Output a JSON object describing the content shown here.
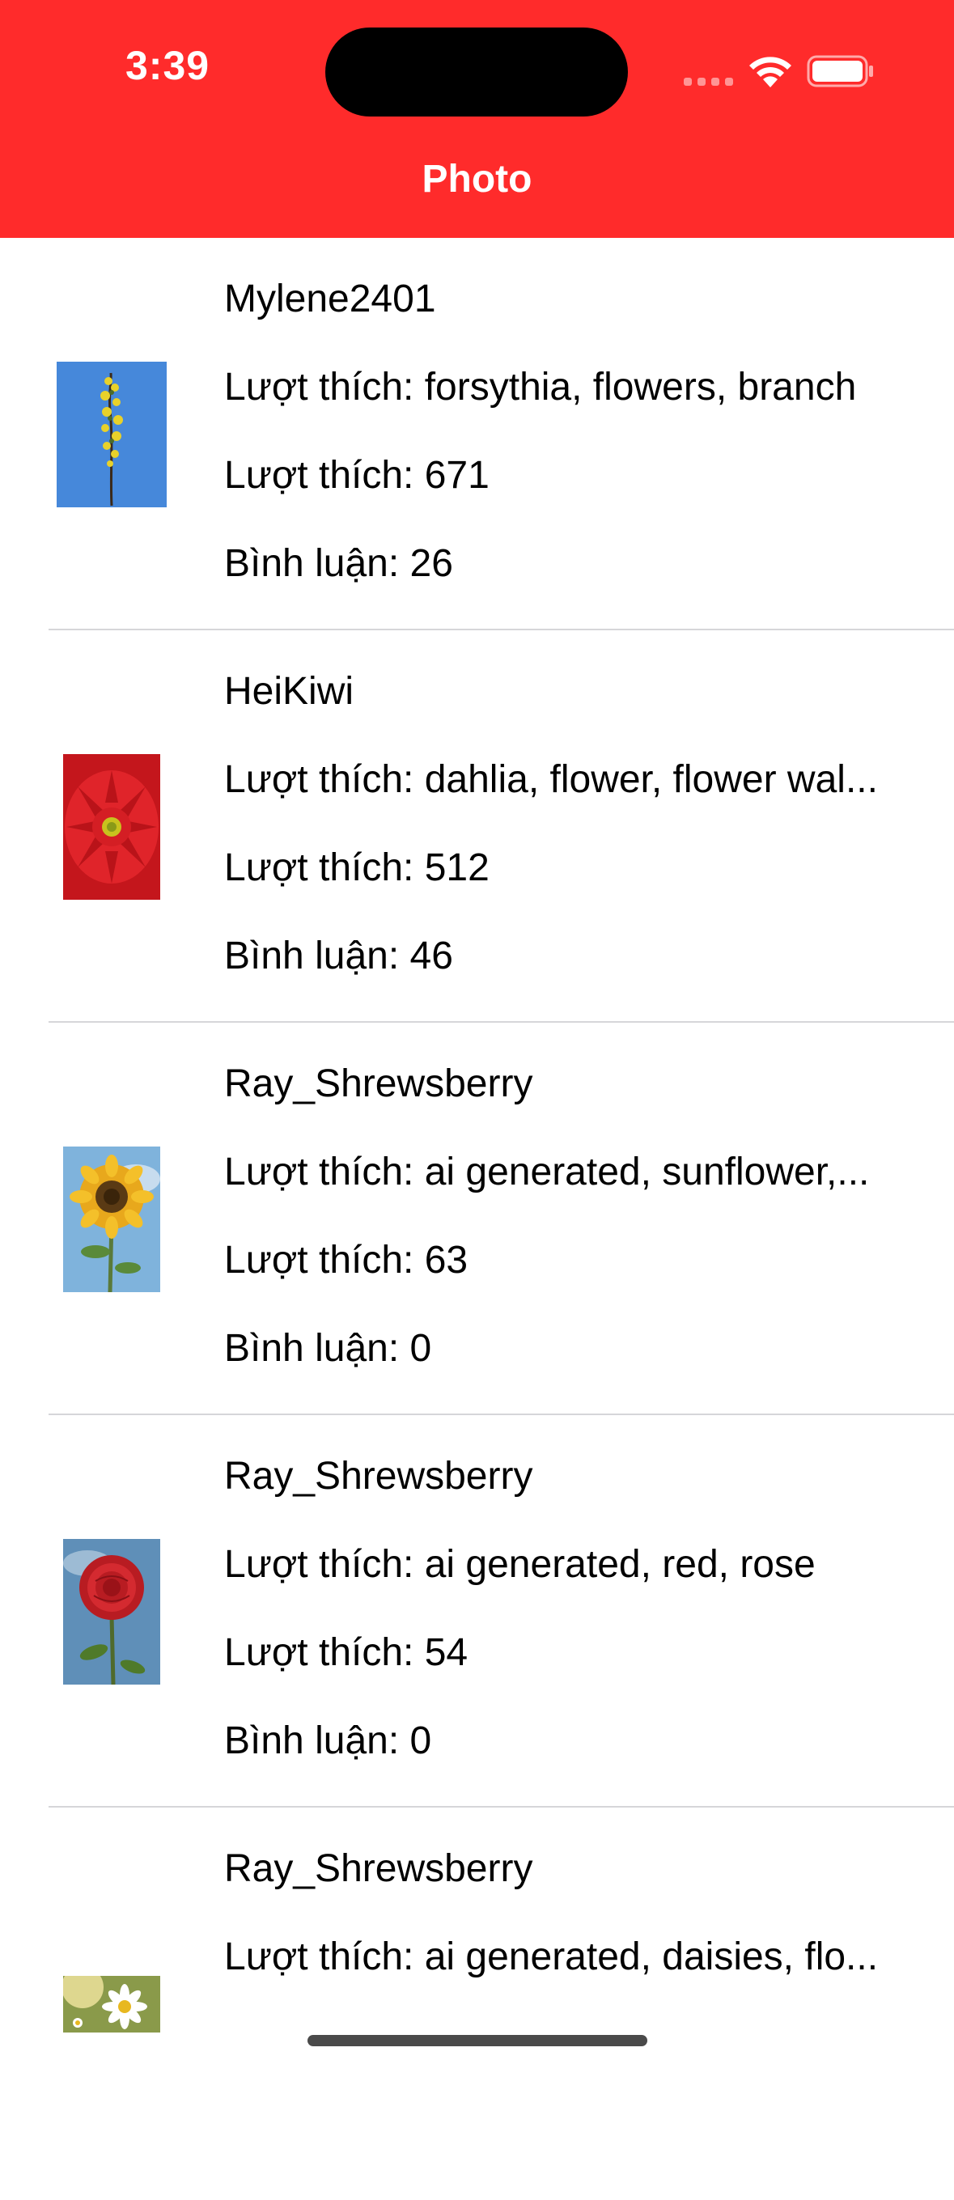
{
  "status_bar": {
    "time": "3:39"
  },
  "nav": {
    "title": "Photo"
  },
  "colors": {
    "header": "#ff2b2b",
    "separator": "#d6d6d9"
  },
  "photos": [
    {
      "user": "Mylene2401",
      "tags": "Lượt thích: forsythia, flowers, branch",
      "likes": "Lượt thích: 671",
      "comments": "Bình luận: 26",
      "thumb_icon": "forsythia-branch-photo"
    },
    {
      "user": "HeiKiwi",
      "tags": "Lượt thích: dahlia, flower, flower wal...",
      "likes": "Lượt thích: 512",
      "comments": "Bình luận: 46",
      "thumb_icon": "red-dahlia-photo"
    },
    {
      "user": "Ray_Shrewsberry",
      "tags": "Lượt thích: ai generated, sunflower,...",
      "likes": "Lượt thích: 63",
      "comments": "Bình luận: 0",
      "thumb_icon": "sunflower-photo"
    },
    {
      "user": "Ray_Shrewsberry",
      "tags": "Lượt thích: ai generated, red, rose",
      "likes": "Lượt thích: 54",
      "comments": "Bình luận: 0",
      "thumb_icon": "red-rose-photo"
    },
    {
      "user": "Ray_Shrewsberry",
      "tags": "Lượt thích: ai generated, daisies, flo...",
      "likes": "",
      "comments": "",
      "thumb_icon": "daisies-photo"
    }
  ]
}
